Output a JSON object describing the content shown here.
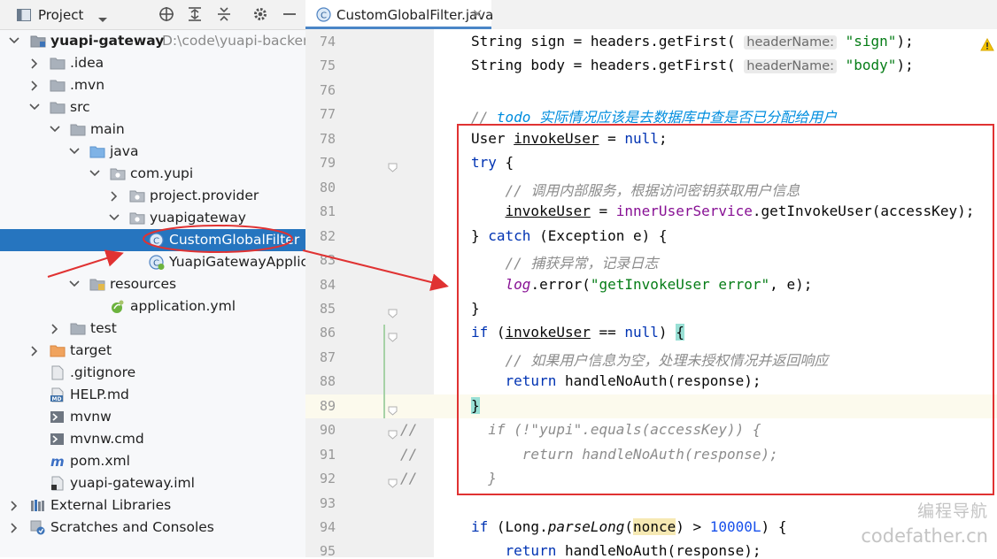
{
  "project_panel": {
    "title": "Project",
    "toolbar_icons": [
      "target-icon",
      "expand-all-icon",
      "collapse-all-icon",
      "gear-icon",
      "minimize-icon"
    ],
    "tree": [
      {
        "label": "yuapi-gateway",
        "path": "D:\\code\\yuapi-backend",
        "icon": "module-folder-icon",
        "expanded": true
      },
      {
        "label": ".idea",
        "icon": "folder-icon",
        "expanded": false
      },
      {
        "label": ".mvn",
        "icon": "folder-icon",
        "expanded": false
      },
      {
        "label": "src",
        "icon": "folder-icon",
        "expanded": true
      },
      {
        "label": "main",
        "icon": "folder-icon",
        "expanded": true
      },
      {
        "label": "java",
        "icon": "source-folder-icon",
        "expanded": true
      },
      {
        "label": "com.yupi",
        "icon": "package-icon",
        "expanded": true
      },
      {
        "label": "project.provider",
        "icon": "package-icon",
        "expanded": false
      },
      {
        "label": "yuapigateway",
        "icon": "package-icon",
        "expanded": true
      },
      {
        "label": "CustomGlobalFilter",
        "icon": "java-class-icon",
        "selected": true
      },
      {
        "label": "YuapiGatewayApplica",
        "icon": "spring-app-class-icon"
      },
      {
        "label": "resources",
        "icon": "resources-folder-icon",
        "expanded": true
      },
      {
        "label": "application.yml",
        "icon": "yml-file-icon"
      },
      {
        "label": "test",
        "icon": "folder-icon",
        "expanded": false
      },
      {
        "label": "target",
        "icon": "excluded-folder-icon",
        "expanded": false
      },
      {
        "label": ".gitignore",
        "icon": "gitignore-file-icon"
      },
      {
        "label": "HELP.md",
        "icon": "markdown-file-icon"
      },
      {
        "label": "mvnw",
        "icon": "shell-file-icon"
      },
      {
        "label": "mvnw.cmd",
        "icon": "cmd-file-icon"
      },
      {
        "label": "pom.xml",
        "icon": "maven-file-icon"
      },
      {
        "label": "yuapi-gateway.iml",
        "icon": "iml-file-icon"
      },
      {
        "label": "External Libraries",
        "icon": "libraries-icon",
        "expanded": false
      },
      {
        "label": "Scratches and Consoles",
        "icon": "scratches-icon",
        "expanded": false
      }
    ]
  },
  "editor": {
    "tab": {
      "label": "CustomGlobalFilter.java",
      "close": "✕",
      "icon": "java-class-icon"
    },
    "current_line": "89",
    "lines": [
      {
        "num": "74",
        "html": "String sign = headers.getFirst( <span class=\"hint\">headerName:</span> <span class=\"str\">\"sign\"</span>);"
      },
      {
        "num": "75",
        "html": "String body = headers.getFirst( <span class=\"hint\">headerName:</span> <span class=\"str\">\"body\"</span>);"
      },
      {
        "num": "76",
        "html": ""
      },
      {
        "num": "77",
        "html": "<span class=\"cmt\">// </span><span class=\"todo\">todo 实际情况应该是去数据库中查是否已分配给用户</span>"
      },
      {
        "num": "78",
        "html": "User <span class=\"var\">invokeUser</span> = <span class=\"kw\">null</span>;"
      },
      {
        "num": "79",
        "html": "<span class=\"kw\">try</span> {"
      },
      {
        "num": "80",
        "html": "    <span class=\"cmt\">// 调用内部服务，根据访问密钥获取用户信息</span>"
      },
      {
        "num": "81",
        "html": "    <span class=\"var\">invokeUser</span> = <span class=\"fld\">innerUserService</span>.getInvokeUser(accessKey);"
      },
      {
        "num": "82",
        "html": "} <span class=\"kw\">catch</span> (Exception e) {"
      },
      {
        "num": "83",
        "html": "    <span class=\"cmt\">// 捕获异常，记录日志</span>"
      },
      {
        "num": "84",
        "html": "    <span class=\"fld ital\">log</span>.error(<span class=\"str\">\"getInvokeUser error\"</span>, e);"
      },
      {
        "num": "85",
        "html": "}"
      },
      {
        "num": "86",
        "html": "<span class=\"kw\">if</span> (<span class=\"var\">invokeUser</span> == <span class=\"kw\">null</span>) <span class=\"brace-hl\">{</span>"
      },
      {
        "num": "87",
        "html": "    <span class=\"cmt\">// 如果用户信息为空，处理未授权情况并返回响应</span>"
      },
      {
        "num": "88",
        "html": "    <span class=\"kw\">return</span> handleNoAuth(response);"
      },
      {
        "num": "89",
        "html": "<span class=\"brace-hl\">}</span>"
      },
      {
        "num": "90",
        "html": "<span class=\"cmt\">  if (!\"yupi\".equals(accessKey)) {</span>"
      },
      {
        "num": "91",
        "html": "<span class=\"cmt\">      return handleNoAuth(response);</span>"
      },
      {
        "num": "92",
        "html": "<span class=\"cmt\">  }</span>"
      },
      {
        "num": "93",
        "html": ""
      },
      {
        "num": "94",
        "html": "<span class=\"kw\">if</span> (Long.<span class=\"ital\">parseLong</span>(<span class=\"nonce-hl\">nonce</span>) &gt; <span class=\"num\">10000L</span>) {"
      },
      {
        "num": "95",
        "html": "    <span class=\"kw\">return</span> handleNoAuth(response);"
      }
    ],
    "comment_slashes": [
      "//",
      "//",
      "//"
    ]
  },
  "colors": {
    "selection": "#2675bf",
    "annotation_red": "#e03232",
    "keyword": "#0033b3",
    "string": "#067d17",
    "comment": "#8c8c8c"
  },
  "watermark": {
    "line1": "编程导航",
    "line2": "codefather.cn"
  }
}
